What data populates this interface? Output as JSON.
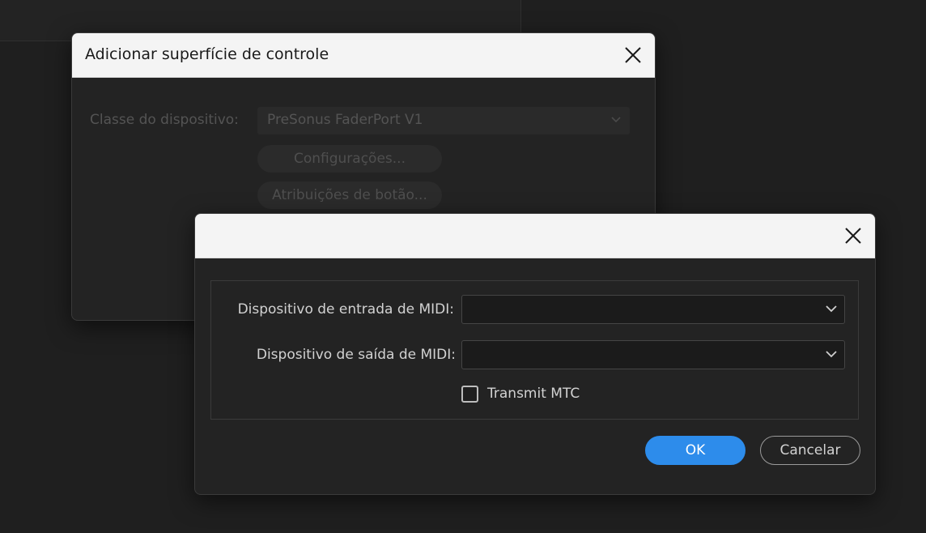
{
  "colors": {
    "accent": "#2d8ceb",
    "background": "#1f1f1f",
    "dialog_bg": "#232323",
    "titlebar_bg": "#f4f4f4"
  },
  "back_dialog": {
    "title": "Adicionar superfície de controle",
    "close_icon": "close-icon",
    "device_class_label": "Classe do dispositivo:",
    "device_class_value": "PreSonus FaderPort V1",
    "settings_button": "Configurações...",
    "button_assignments_button": "Atribuições de botão..."
  },
  "front_dialog": {
    "title": "",
    "close_icon": "close-icon",
    "midi_input_label": "Dispositivo de entrada de MIDI:",
    "midi_input_value": "",
    "midi_output_label": "Dispositivo de saída de MIDI:",
    "midi_output_value": "",
    "transmit_mtc_label": "Transmit MTC",
    "transmit_mtc_checked": false,
    "ok_button": "OK",
    "cancel_button": "Cancelar"
  }
}
